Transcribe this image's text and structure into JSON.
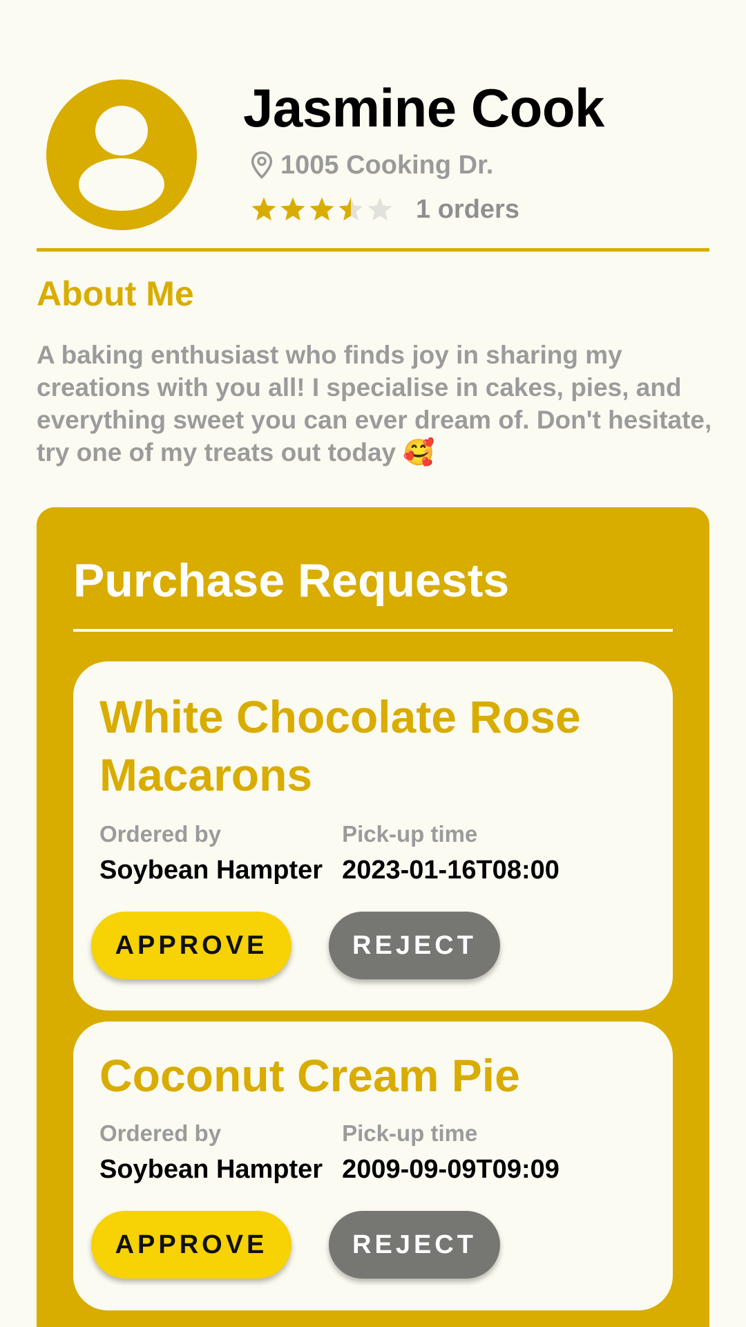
{
  "profile": {
    "name": "Jasmine Cook",
    "address": "1005 Cooking Dr.",
    "rating": 3.5,
    "rating_max": 5,
    "orders": "1 orders"
  },
  "about": {
    "title": "About Me",
    "text": "A baking enthusiast who finds joy in sharing my creations with you all! I specialise in cakes, pies, and everything sweet you can ever dream of. Don't hesitate, try one of my treats out today 🥰"
  },
  "requests": {
    "title": "Purchase Requests",
    "items": [
      {
        "title": "White Chocolate Rose Macarons",
        "ordered_by_label": "Ordered by",
        "ordered_by": "Soybean Hampter",
        "pickup_label": "Pick-up time",
        "pickup": "2023-01-16T08:00",
        "approve_label": "APPROVE",
        "reject_label": "REJECT"
      },
      {
        "title": "Coconut Cream Pie",
        "ordered_by_label": "Ordered by",
        "ordered_by": "Soybean Hampter",
        "pickup_label": "Pick-up time",
        "pickup": "2009-09-09T09:09",
        "approve_label": "APPROVE",
        "reject_label": "REJECT"
      }
    ]
  },
  "colors": {
    "accent": "#D9AC00",
    "background": "#FCFBF2",
    "approve": "#F7D204",
    "reject": "#767672",
    "muted_text": "#9B9B9B"
  },
  "icons": {
    "avatar": "person-icon",
    "location": "location-pin-icon",
    "star": "star-icon"
  }
}
